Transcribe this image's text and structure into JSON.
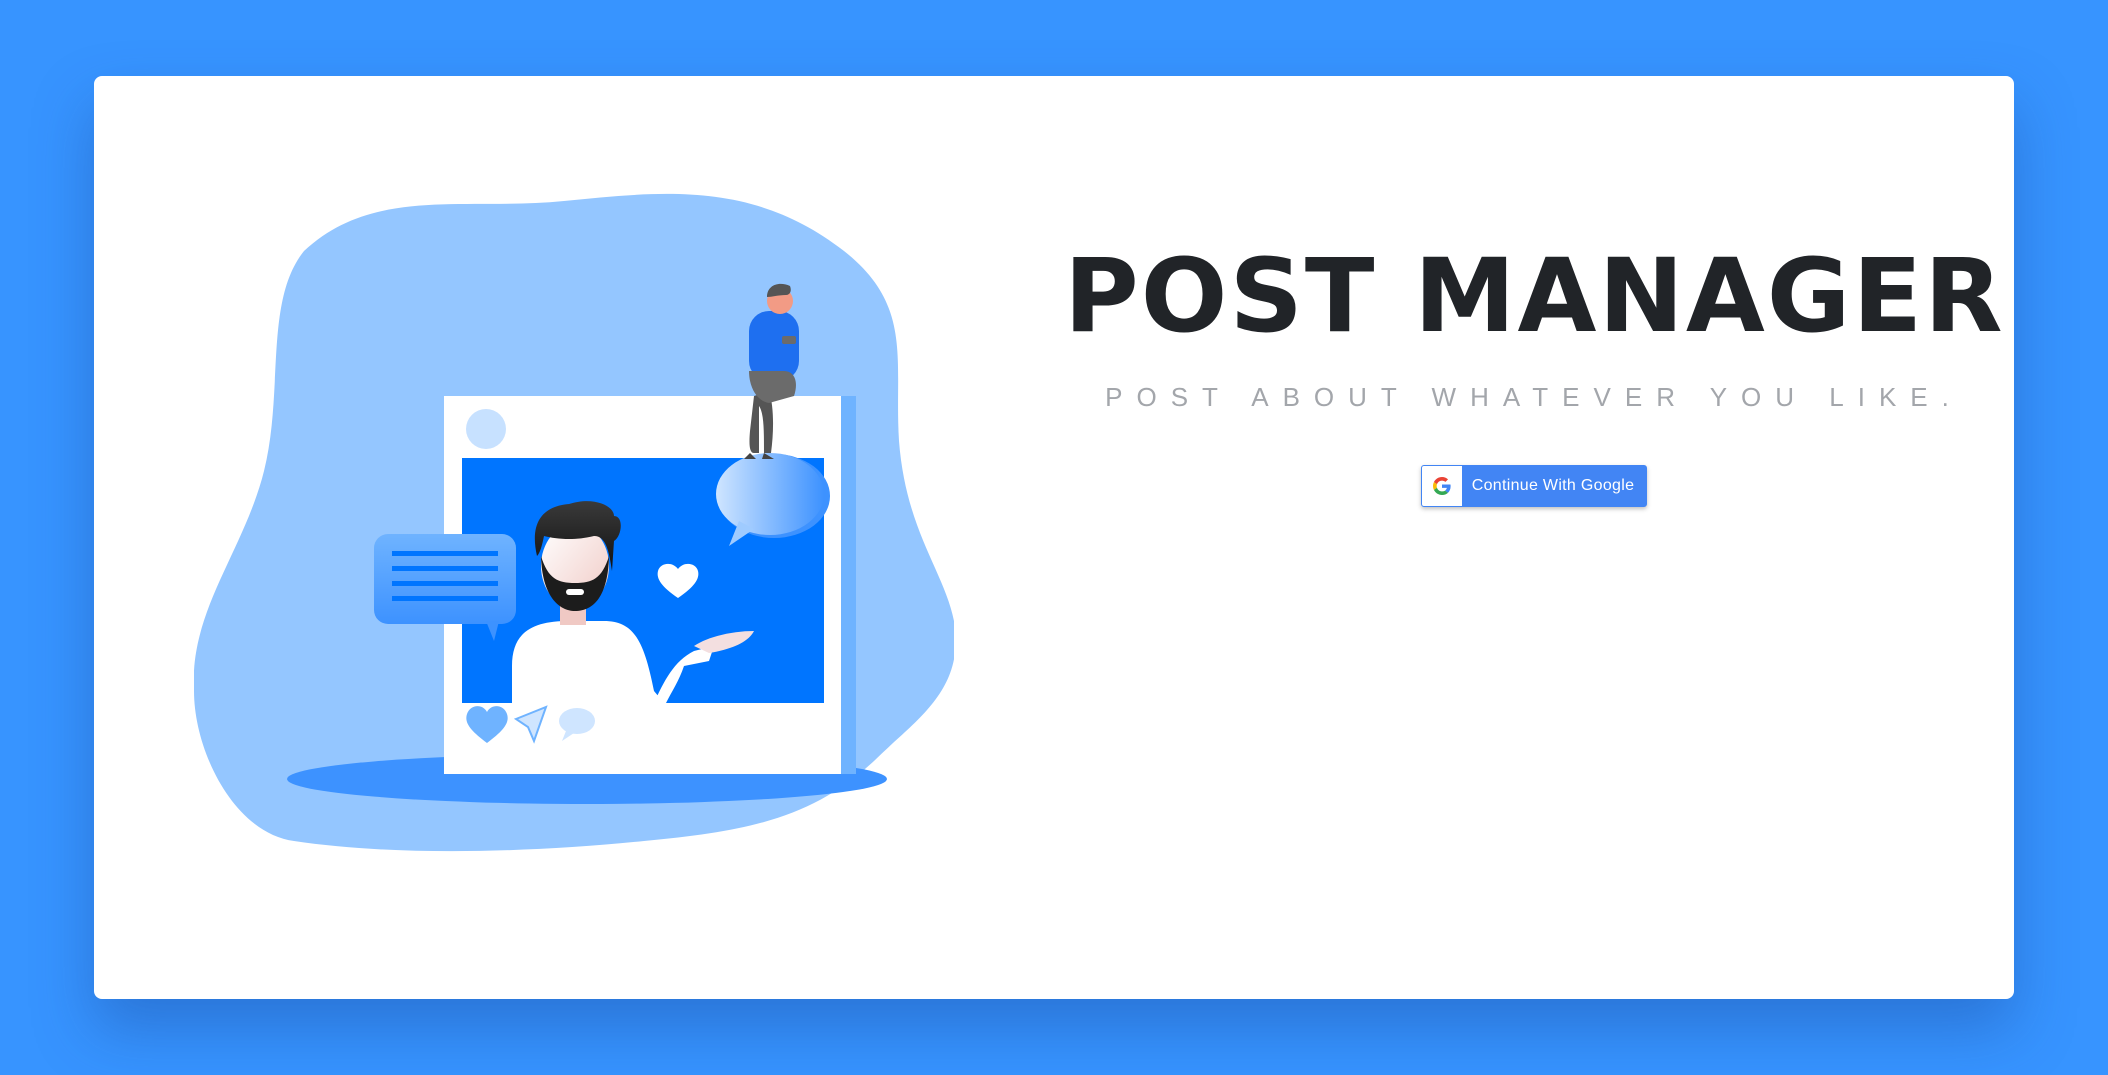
{
  "hero": {
    "title": "POST MANAGER",
    "tagline": "POST ABOUT WHATEVER YOU LIKE."
  },
  "login": {
    "google_button_label": "Continue With Google",
    "google_icon": "google-g-icon"
  },
  "colors": {
    "page_background": "#3794ff",
    "card_background": "#ffffff",
    "accent_blue": "#0075ff",
    "light_blue": "#94c6ff",
    "title_color": "#212428",
    "tagline_color": "#a3a6ab",
    "google_blue": "#4285f4"
  },
  "illustration": {
    "icons": [
      "heart-icon",
      "send-icon",
      "comment-icon",
      "chat-bubble-icon",
      "message-lines-icon"
    ]
  }
}
